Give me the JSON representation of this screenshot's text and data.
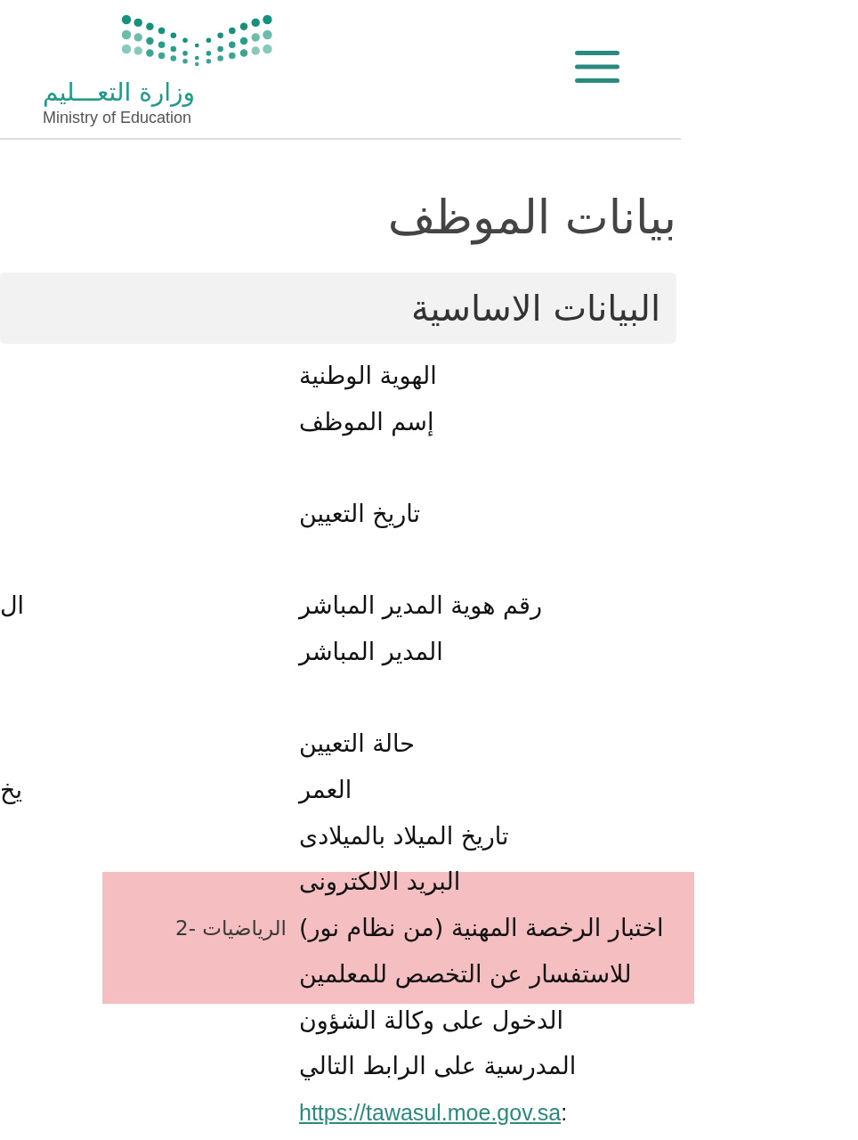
{
  "header": {
    "logo": {
      "arabic": "وزارة التعـــليم",
      "english": "Ministry of Education"
    }
  },
  "page_title": "بيانات الموظف",
  "section": {
    "title": "البيانات الاساسية",
    "field_groups": [
      {
        "fields": [
          {
            "label": "الهوية الوطنية",
            "highlighted": false
          },
          {
            "label": "إسم الموظف",
            "highlighted": false
          }
        ]
      },
      {
        "fields": [
          {
            "label": "تاريخ التعيين",
            "highlighted": false
          }
        ]
      },
      {
        "fields": [
          {
            "label": "رقم هوية المدير المباشر",
            "column_3": "ال",
            "highlighted": false
          },
          {
            "label": "المدير المباشر",
            "highlighted": false
          }
        ]
      },
      {
        "fields": [
          {
            "label": "حالة التعيين",
            "highlighted": false
          },
          {
            "label": "العمر",
            "column_3": "يخ",
            "highlighted": false
          },
          {
            "label": "تاريخ الميلاد بالميلادى",
            "highlighted": false
          },
          {
            "label": "البريد الالكترونى",
            "highlighted": true
          },
          {
            "label": "اختبار الرخصة المهنية (من نظام نور)",
            "value": "الرياضيات -2",
            "highlighted": true
          }
        ]
      }
    ],
    "note": {
      "lines": [
        {
          "text": "للاستفسار عن التخصص للمعلمين",
          "highlighted": true
        },
        {
          "text": "الدخول على وكالة الشؤون",
          "highlighted": false
        },
        {
          "text": "المدرسية على الرابط التالي",
          "highlighted": false
        }
      ],
      "link": "https://tawasul.moe.gov.sa",
      "link_suffix": ":"
    }
  }
}
